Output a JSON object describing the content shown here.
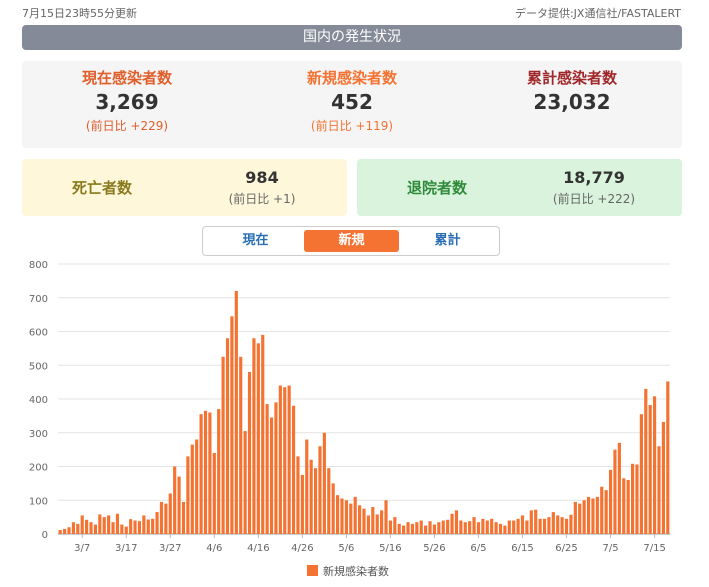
{
  "header": {
    "updated": "7月15日23時55分更新",
    "source": "データ提供:JX通信社/FASTALERT",
    "title": "国内の発生状況"
  },
  "stats": {
    "current": {
      "label": "現在感染者数",
      "value": "3,269",
      "diff": "(前日比 +229)",
      "color": "#e05e2c"
    },
    "new": {
      "label": "新規感染者数",
      "value": "452",
      "diff": "(前日比 +119)",
      "color": "#f47332"
    },
    "total": {
      "label": "累計感染者数",
      "value": "23,032",
      "color": "#a0282b"
    },
    "deaths": {
      "label": "死亡者数",
      "value": "984",
      "diff": "(前日比 +1)",
      "color": "#8a7a1e",
      "bg": "#fef7d9"
    },
    "discharged": {
      "label": "退院者数",
      "value": "18,779",
      "diff": "(前日比 +222)",
      "color": "#2f8a3a",
      "bg": "#d9f3dc"
    }
  },
  "tabs": [
    {
      "label": "現在",
      "active": false
    },
    {
      "label": "新規",
      "active": true
    },
    {
      "label": "累計",
      "active": false
    }
  ],
  "chart_data": {
    "type": "bar",
    "bar_color": "#f47332",
    "ylim": [
      0,
      800
    ],
    "yticks": [
      0,
      100,
      200,
      300,
      400,
      500,
      600,
      700,
      800
    ],
    "xticks": [
      "3/7",
      "3/17",
      "3/27",
      "4/6",
      "4/16",
      "4/26",
      "5/6",
      "5/16",
      "5/26",
      "6/5",
      "6/15",
      "6/25",
      "7/5",
      "7/15"
    ],
    "xtick_index": [
      5,
      15,
      25,
      35,
      45,
      55,
      65,
      75,
      85,
      95,
      105,
      115,
      125,
      135
    ],
    "series": [
      {
        "name": "新規感染者数",
        "values": [
          12,
          15,
          20,
          35,
          30,
          55,
          42,
          35,
          28,
          58,
          50,
          55,
          35,
          60,
          28,
          22,
          44,
          40,
          38,
          55,
          43,
          45,
          65,
          95,
          90,
          120,
          200,
          170,
          95,
          230,
          265,
          280,
          355,
          365,
          360,
          240,
          370,
          525,
          580,
          645,
          720,
          525,
          305,
          480,
          580,
          565,
          590,
          385,
          345,
          390,
          440,
          435,
          440,
          380,
          230,
          175,
          280,
          220,
          195,
          260,
          300,
          195,
          150,
          115,
          105,
          100,
          90,
          110,
          85,
          75,
          55,
          80,
          58,
          70,
          100,
          40,
          50,
          30,
          25,
          35,
          30,
          35,
          40,
          25,
          38,
          28,
          35,
          40,
          42,
          60,
          70,
          40,
          35,
          38,
          50,
          35,
          45,
          40,
          45,
          35,
          30,
          25,
          40,
          40,
          45,
          55,
          40,
          70,
          72,
          45,
          45,
          50,
          65,
          55,
          50,
          45,
          57,
          95,
          90,
          100,
          110,
          105,
          110,
          140,
          130,
          190,
          250,
          270,
          165,
          160,
          208,
          206,
          355,
          430,
          382,
          408,
          260,
          332,
          452
        ]
      }
    ],
    "legend": "新規感染者数"
  }
}
